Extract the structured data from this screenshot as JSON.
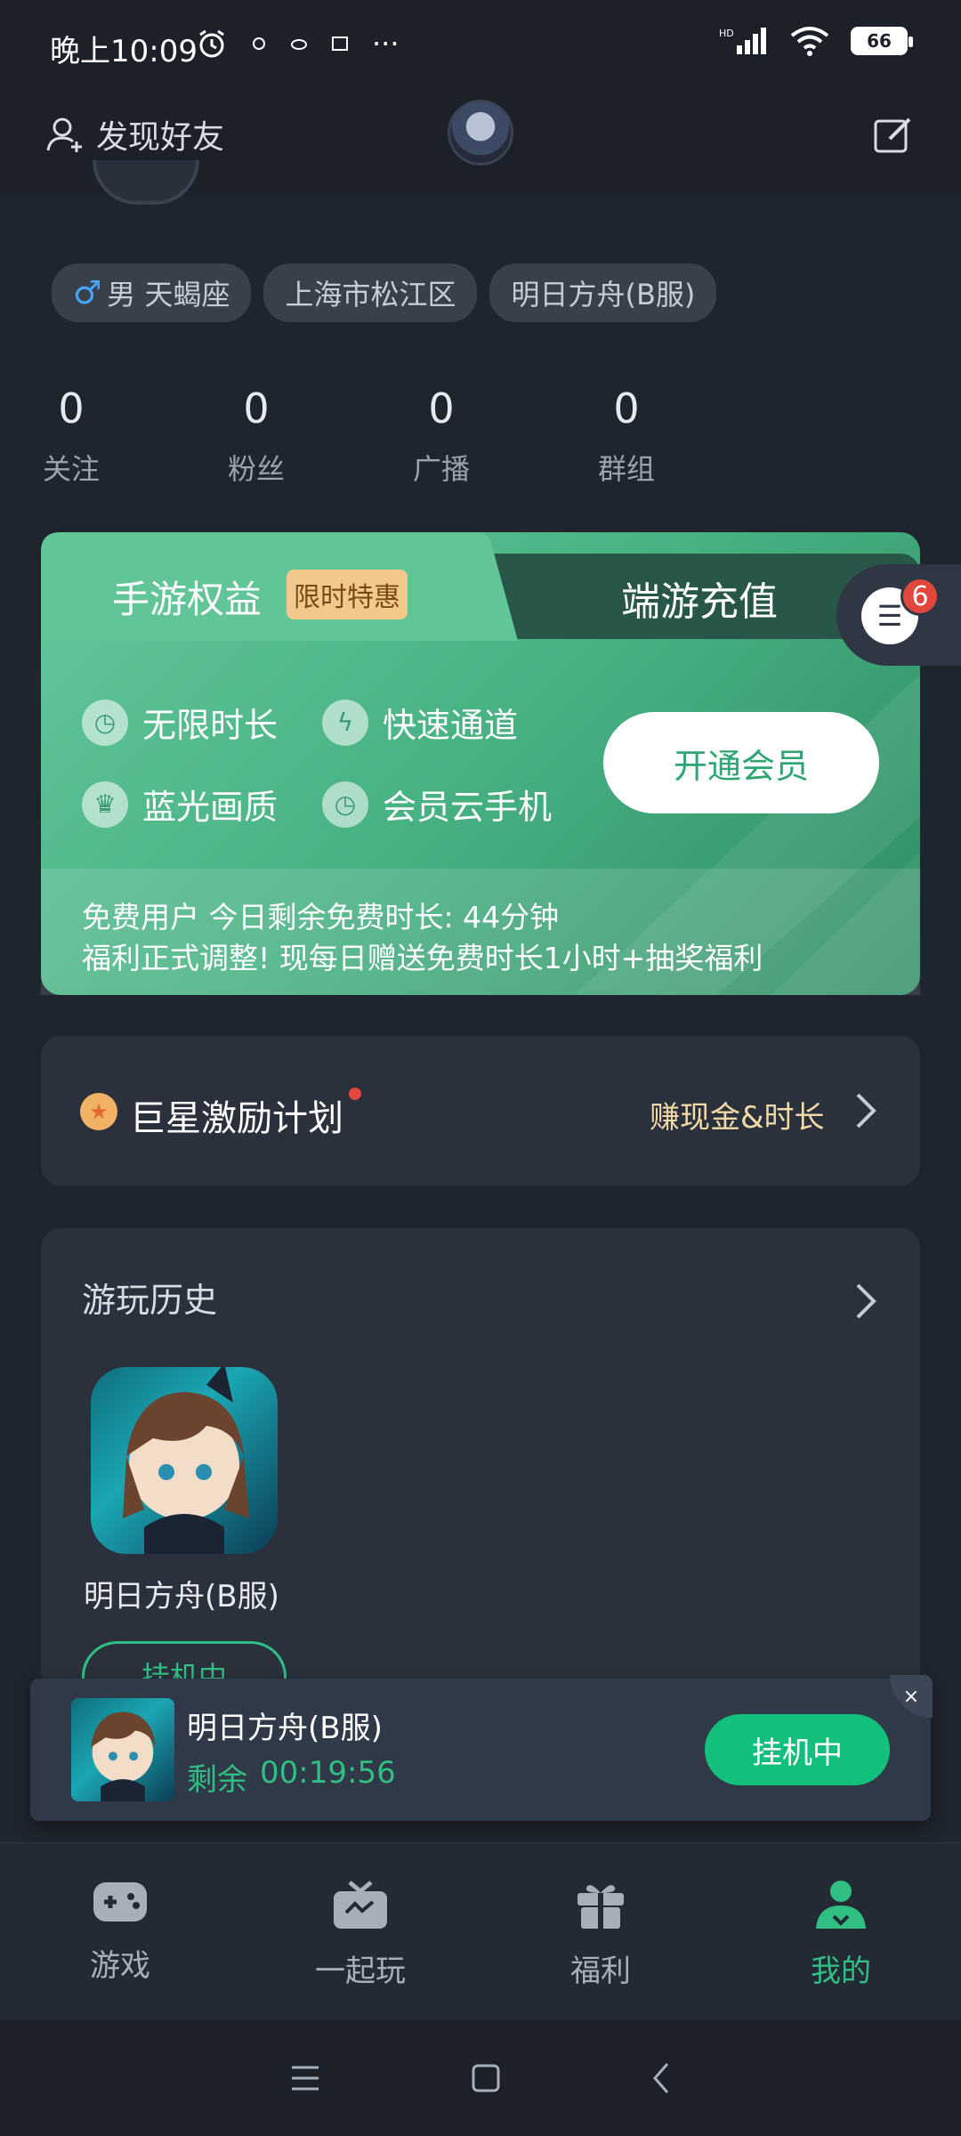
{
  "status_bar": {
    "time": "晚上10:09",
    "battery": "66",
    "more_dots": "···"
  },
  "header": {
    "find_friends": "发现好友"
  },
  "profile": {
    "tags": [
      {
        "icon": "male-icon",
        "text": "男 天蝎座"
      },
      {
        "text": "上海市松江区"
      },
      {
        "text": "明日方舟(B服)"
      }
    ],
    "stats": [
      {
        "value": "0",
        "label": "关注"
      },
      {
        "value": "0",
        "label": "粉丝"
      },
      {
        "value": "0",
        "label": "广播"
      },
      {
        "value": "0",
        "label": "群组"
      }
    ]
  },
  "vip_card": {
    "tab_left": "手游权益",
    "badge": "限时特惠",
    "tab_right": "端游充值",
    "features": [
      "无限时长",
      "快速通道",
      "蓝光画质",
      "会员云手机"
    ],
    "open_button": "开通会员",
    "footer_line1": "免费用户 今日剩余免费时长: 44分钟",
    "footer_line2": "福利正式调整! 现每日赠送免费时长1小时+抽奖福利"
  },
  "chat_float": {
    "badge_count": "6"
  },
  "star_plan": {
    "title": "巨星激励计划",
    "link": "赚现金&时长"
  },
  "history": {
    "title": "游玩历史",
    "games": [
      {
        "name": "明日方舟(B服)",
        "button": "挂机中"
      }
    ]
  },
  "mini_player": {
    "title": "明日方舟(B服)",
    "remaining_label": "剩余",
    "remaining_time": "00:19:56",
    "button": "挂机中",
    "close": "×"
  },
  "bottom_nav": [
    {
      "label": "游戏",
      "icon": "gamepad-icon",
      "active": false
    },
    {
      "label": "一起玩",
      "icon": "tv-icon",
      "active": false
    },
    {
      "label": "福利",
      "icon": "gift-icon",
      "active": false
    },
    {
      "label": "我的",
      "icon": "person-icon",
      "active": true
    }
  ],
  "colors": {
    "accent": "#2fbf83",
    "background": "#1f252e",
    "card": "#2a313c"
  }
}
